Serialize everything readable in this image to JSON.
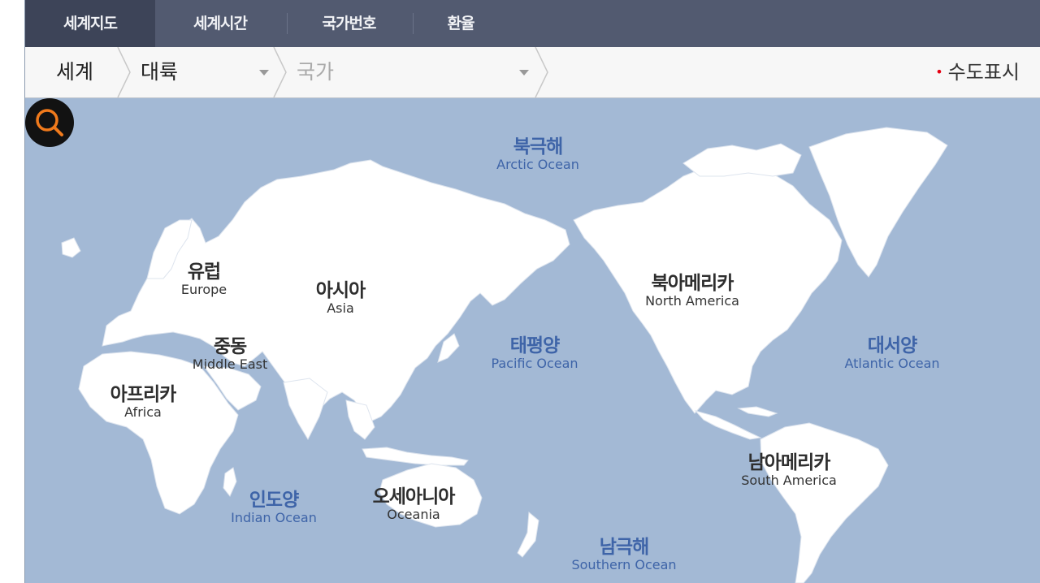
{
  "tabs": [
    {
      "label": "세계지도",
      "active": true
    },
    {
      "label": "세계시간",
      "active": false
    },
    {
      "label": "국가번호",
      "active": false
    },
    {
      "label": "환율",
      "active": false
    }
  ],
  "breadcrumb": {
    "world": "세계",
    "continent_select": "대륙",
    "country_select": "국가"
  },
  "capital_toggle": {
    "label": "수도표시",
    "bullet": "•",
    "bullet_color": "#e60012"
  },
  "search": {
    "icon": "search-icon",
    "icon_color": "#f07a1c"
  },
  "colors": {
    "tab_bg": "#525a70",
    "tab_active_bg": "#3d4458",
    "ocean": "#a3b9d5",
    "land": "#ffffff",
    "ocean_text": "#3e64a8"
  },
  "map": {
    "continents": [
      {
        "ko": "유럽",
        "en": "Europe"
      },
      {
        "ko": "아시아",
        "en": "Asia"
      },
      {
        "ko": "중동",
        "en": "Middle East"
      },
      {
        "ko": "아프리카",
        "en": "Africa"
      },
      {
        "ko": "오세아니아",
        "en": "Oceania"
      },
      {
        "ko": "북아메리카",
        "en": "North America"
      },
      {
        "ko": "남아메리카",
        "en": "South America"
      }
    ],
    "oceans": [
      {
        "ko": "북극해",
        "en": "Arctic Ocean"
      },
      {
        "ko": "태평양",
        "en": "Pacific Ocean"
      },
      {
        "ko": "대서양",
        "en": "Atlantic Ocean"
      },
      {
        "ko": "인도양",
        "en": "Indian Ocean"
      },
      {
        "ko": "남극해",
        "en": "Southern Ocean"
      }
    ]
  }
}
